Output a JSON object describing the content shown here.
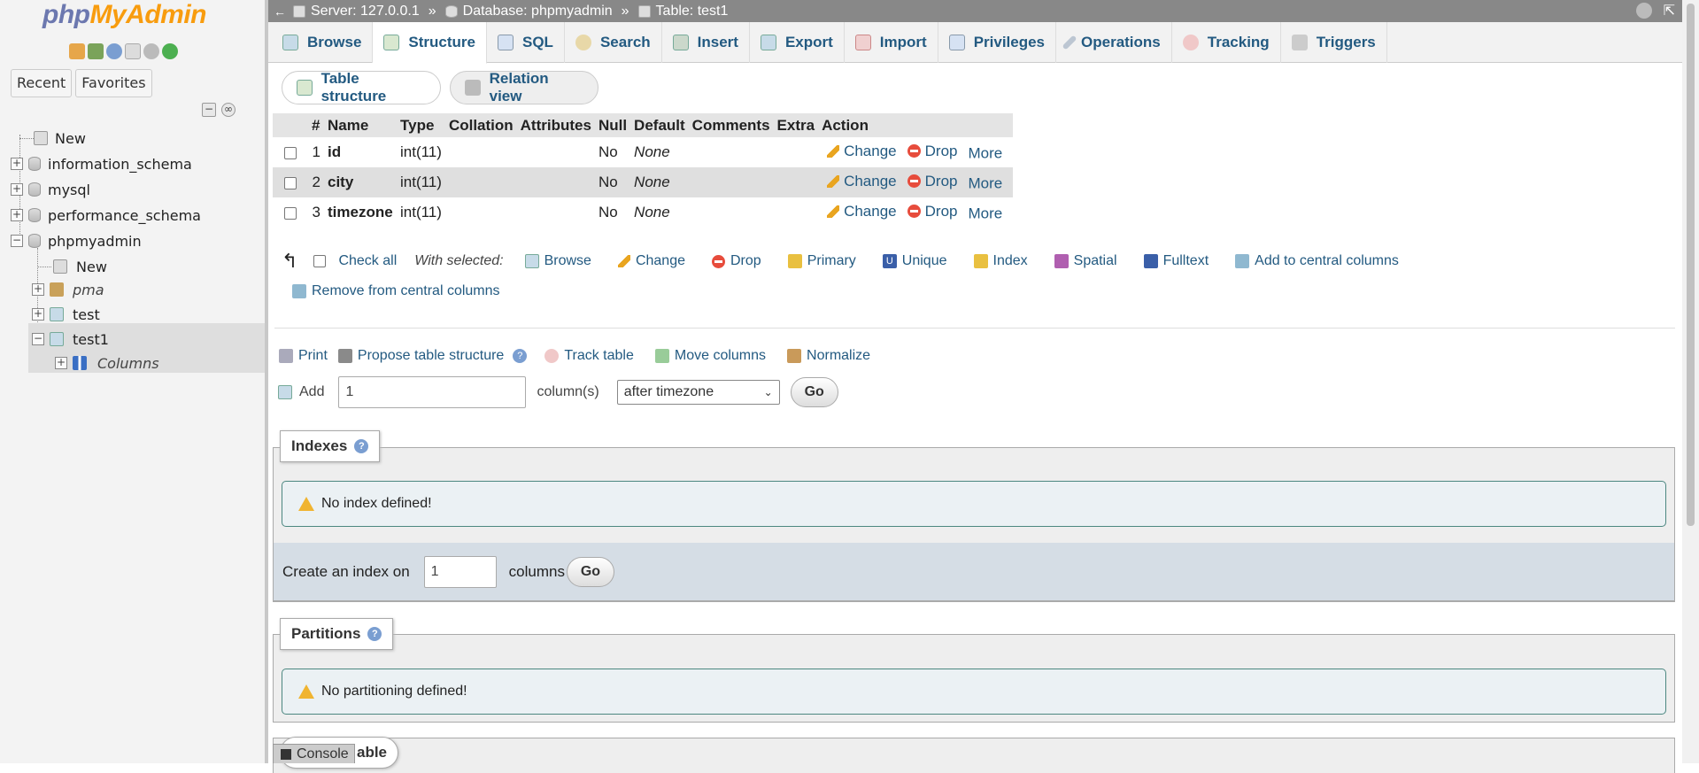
{
  "nav": {
    "logo_php": "php",
    "logo_myadmin": "MyAdmin",
    "tabs": [
      "Recent",
      "Favorites"
    ],
    "tree": {
      "new": "New",
      "dbs": [
        "information_schema",
        "mysql",
        "performance_schema",
        "phpmyadmin"
      ],
      "sub_new": "New",
      "tables": [
        "pma",
        "test",
        "test1"
      ],
      "columns": "Columns"
    }
  },
  "breadcrumb": {
    "server": "Server: 127.0.0.1",
    "database": "Database: phpmyadmin",
    "table": "Table: test1",
    "sep": "»"
  },
  "tabs": [
    "Browse",
    "Structure",
    "SQL",
    "Search",
    "Insert",
    "Export",
    "Import",
    "Privileges",
    "Operations",
    "Tracking",
    "Triggers"
  ],
  "subtabs": {
    "structure": "Table structure",
    "relation": "Relation view"
  },
  "table": {
    "headers": [
      "#",
      "Name",
      "Type",
      "Collation",
      "Attributes",
      "Null",
      "Default",
      "Comments",
      "Extra",
      "Action"
    ],
    "rows": [
      {
        "num": "1",
        "name": "id",
        "type": "int(11)",
        "null": "No",
        "default": "None"
      },
      {
        "num": "2",
        "name": "city",
        "type": "int(11)",
        "null": "No",
        "default": "None"
      },
      {
        "num": "3",
        "name": "timezone",
        "type": "int(11)",
        "null": "No",
        "default": "None"
      }
    ],
    "actions": {
      "change": "Change",
      "drop": "Drop",
      "more": "More"
    }
  },
  "with_selected": {
    "check_all": "Check all",
    "label": "With selected:",
    "items": [
      "Browse",
      "Change",
      "Drop",
      "Primary",
      "Unique",
      "Index",
      "Spatial",
      "Fulltext",
      "Add to central columns"
    ],
    "remove": "Remove from central columns"
  },
  "tools": [
    "Print",
    "Propose table structure",
    "Track table",
    "Move columns",
    "Normalize"
  ],
  "add": {
    "label": "Add",
    "value": "1",
    "unit": "column(s)",
    "position": "after timezone",
    "go": "Go"
  },
  "indexes": {
    "legend": "Indexes",
    "notice": "No index defined!",
    "create_label": "Create an index on",
    "create_value": "1",
    "create_unit": "columns",
    "go": "Go"
  },
  "partitions": {
    "legend": "Partitions",
    "notice": "No partitioning defined!"
  },
  "bottom_legend": "able",
  "console": "Console"
}
